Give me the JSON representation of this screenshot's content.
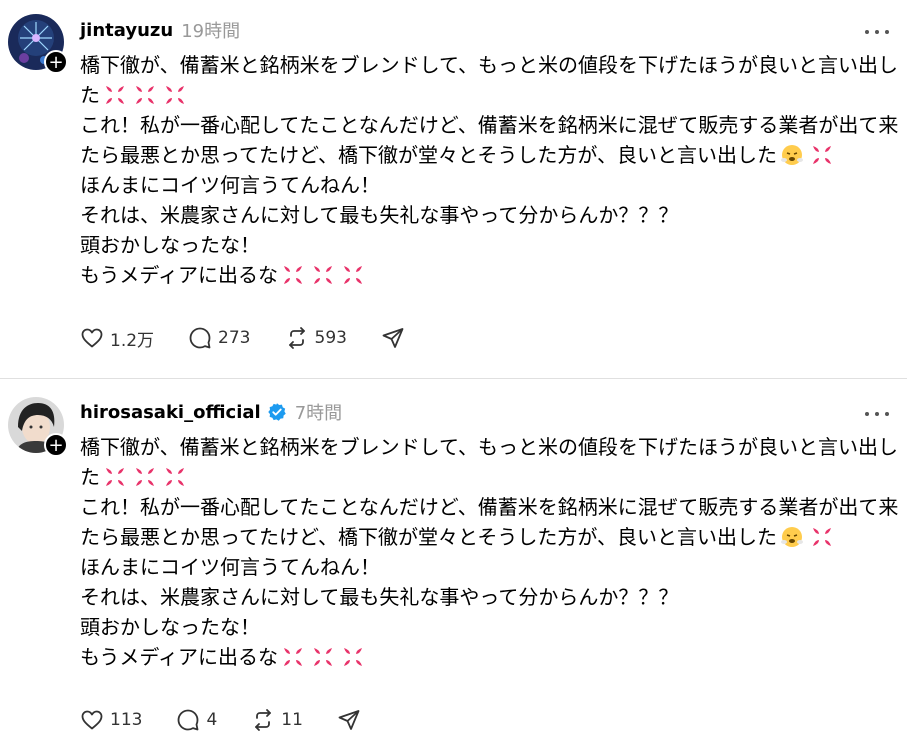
{
  "colors": {
    "text": "#000000",
    "muted": "#999999",
    "verified": "#1d9bf0",
    "anger_symbol": "#e8336a",
    "divider": "#e0e0e0"
  },
  "posts": [
    {
      "username": "jintayuzu",
      "verified": false,
      "time": "19時間",
      "avatar_icon": "fireworks-avatar",
      "follow_badge": "+",
      "lines": [
        {
          "text": "橋下徹が、備蓄米と銘柄米をブレンドして、もっと米の値段を下げたほうが良いと言い出し",
          "emojis": []
        },
        {
          "text": "た",
          "emojis": [
            "anger-symbol",
            "anger-symbol",
            "anger-symbol"
          ]
        },
        {
          "text": "これ！私が一番心配してたことなんだけど、備蓄米を銘柄米に混ぜて販売する業者が出て来",
          "emojis": []
        },
        {
          "text": "たら最悪とか思ってたけど、橋下徹が堂々とそうした方が、良いと言い出した",
          "emojis": [
            "steam-face",
            "anger-symbol"
          ]
        },
        {
          "text": "ほんまにコイツ何言うてんねん！",
          "emojis": []
        },
        {
          "text": "それは、米農家さんに対して最も失礼な事やって分からんか？？？",
          "emojis": []
        },
        {
          "text": "頭おかしなったな！",
          "emojis": []
        },
        {
          "text": "もうメディアに出るな",
          "emojis": [
            "anger-symbol",
            "anger-symbol",
            "anger-symbol"
          ]
        }
      ],
      "actions": {
        "likes": "1.2万",
        "replies": "273",
        "reposts": "593"
      }
    },
    {
      "username": "hirosasaki_official",
      "verified": true,
      "time": "7時間",
      "avatar_icon": "person-avatar",
      "follow_badge": "+",
      "lines": [
        {
          "text": "橋下徹が、備蓄米と銘柄米をブレンドして、もっと米の値段を下げたほうが良いと言い出し",
          "emojis": []
        },
        {
          "text": "た",
          "emojis": [
            "anger-symbol",
            "anger-symbol",
            "anger-symbol"
          ]
        },
        {
          "text": "これ！私が一番心配してたことなんだけど、備蓄米を銘柄米に混ぜて販売する業者が出て来",
          "emojis": []
        },
        {
          "text": "たら最悪とか思ってたけど、橋下徹が堂々とそうした方が、良いと言い出した",
          "emojis": [
            "steam-face",
            "anger-symbol"
          ]
        },
        {
          "text": "ほんまにコイツ何言うてんねん！",
          "emojis": []
        },
        {
          "text": "それは、米農家さんに対して最も失礼な事やって分からんか？？？",
          "emojis": []
        },
        {
          "text": "頭おかしなったな！",
          "emojis": []
        },
        {
          "text": "もうメディアに出るな",
          "emojis": [
            "anger-symbol",
            "anger-symbol",
            "anger-symbol"
          ]
        }
      ],
      "actions": {
        "likes": "113",
        "replies": "4",
        "reposts": "11"
      }
    }
  ]
}
